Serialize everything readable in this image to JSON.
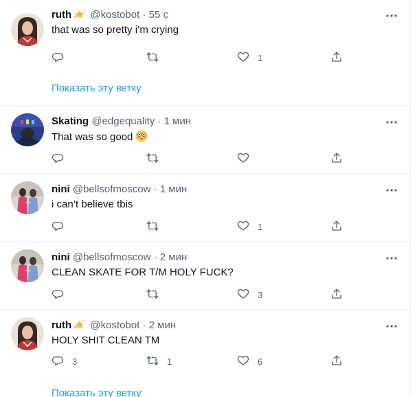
{
  "tweets": [
    {
      "name": "ruth",
      "handle": "@kostobot",
      "dot": "·",
      "time": "55 с",
      "text": "that was so pretty i’m crying",
      "verified": true,
      "emoji": "",
      "replies": "",
      "retweets": "",
      "likes": "1",
      "show_thread": "Показать эту ветку",
      "avatar": "avatar-ruth"
    },
    {
      "name": "Skating",
      "handle": "@edgequality",
      "dot": "·",
      "time": "1 мин",
      "text": "That was so good",
      "verified": false,
      "emoji": "flushed-face",
      "replies": "",
      "retweets": "",
      "likes": "",
      "show_thread": "",
      "avatar": "avatar-skating"
    },
    {
      "name": "nini",
      "handle": "@bellsofmoscow",
      "dot": "·",
      "time": "1 мин",
      "text": "i can’t believe tbis",
      "verified": false,
      "emoji": "",
      "replies": "",
      "retweets": "",
      "likes": "1",
      "show_thread": "",
      "avatar": "avatar-nini"
    },
    {
      "name": "nini",
      "handle": "@bellsofmoscow",
      "dot": "·",
      "time": "2 мин",
      "text": "CLEAN SKATE FOR T/M HOLY FUCK?",
      "verified": false,
      "emoji": "",
      "replies": "",
      "retweets": "",
      "likes": "3",
      "show_thread": "",
      "avatar": "avatar-nini"
    },
    {
      "name": "ruth",
      "handle": "@kostobot",
      "dot": "·",
      "time": "2 мин",
      "text": "HOLY SHIT CLEAN TM",
      "verified": true,
      "emoji": "",
      "replies": "3",
      "retweets": "1",
      "likes": "6",
      "show_thread": "Показать эту ветку",
      "avatar": "avatar-ruth"
    }
  ],
  "colors": {
    "link": "#1d9bf0",
    "secondary_text": "#536471",
    "primary_text": "#0f1419",
    "divider": "#eff3f4",
    "badge": "#f4b63a"
  },
  "icons": {
    "reply": "reply-icon",
    "retweet": "retweet-icon",
    "like": "heart-icon",
    "share": "share-icon",
    "more": "more-dots-icon",
    "badge": "sparkle-star-icon"
  }
}
